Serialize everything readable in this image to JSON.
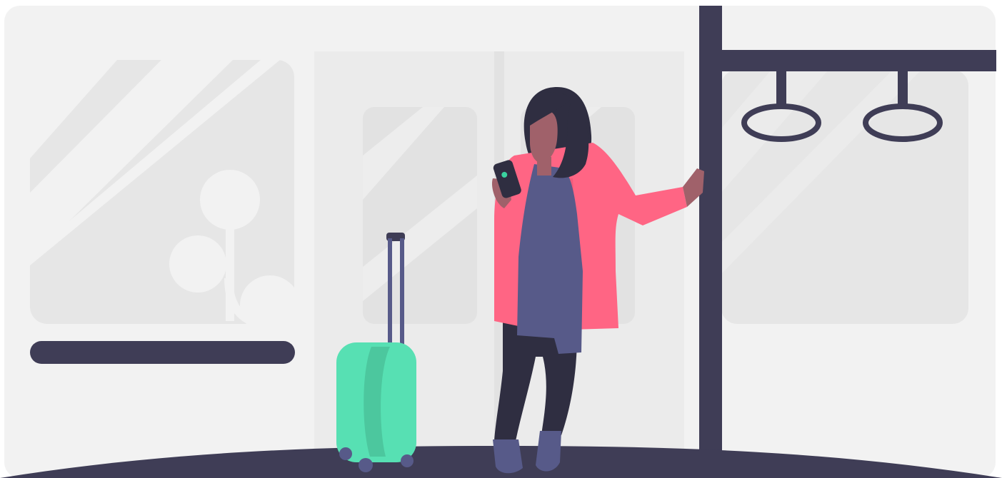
{
  "illustration": {
    "colors": {
      "background": "#ffffff",
      "train_wall": "#f2f2f2",
      "window_panel": "#e6e6e6",
      "door_panel": "#ebebeb",
      "window_glare": "#f2f2f2",
      "plant": "#f2f2f2",
      "dark_metal": "#3f3d56",
      "hair_and_pants": "#2f2e41",
      "skin": "#a0616a",
      "coat": "#ff6584",
      "scarf": "#575a89",
      "shirt": "#3ad29f",
      "suitcase": "#57e0b3",
      "suitcase_shadow": "#4cc79e",
      "suitcase_handle": "#575a89",
      "shoes": "#575a89",
      "phone_screen": "#3ad29f"
    },
    "icons": [
      "train-interior",
      "woman-with-phone",
      "rolling-suitcase",
      "grab-handles",
      "pole"
    ]
  }
}
